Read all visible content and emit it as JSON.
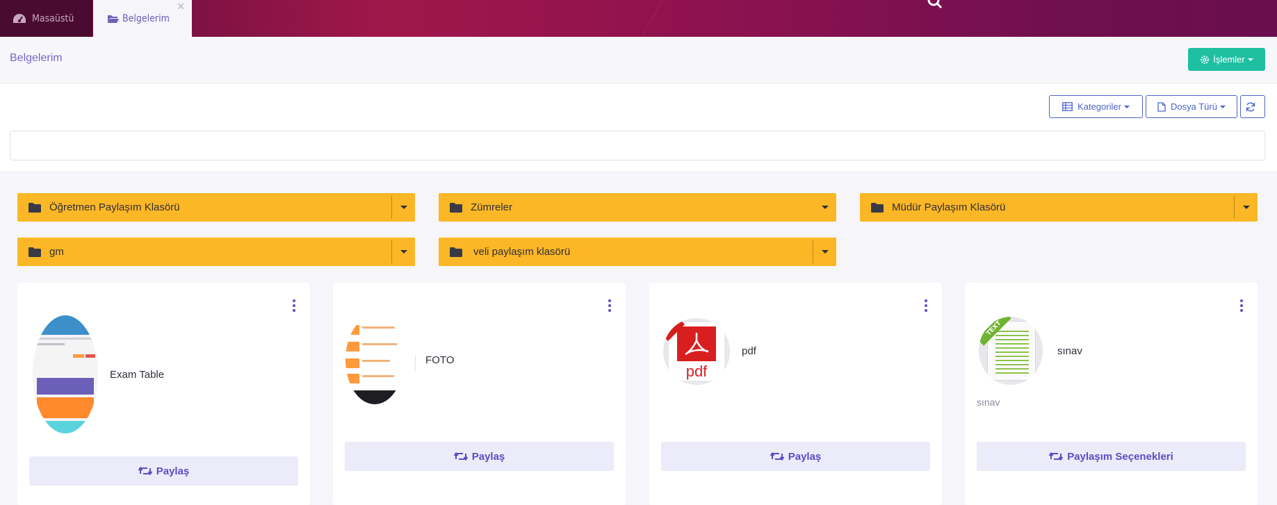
{
  "tabs": {
    "home_label": "Masaüstü",
    "active_label": "Belgelerim",
    "close_symbol": "×"
  },
  "header": {
    "title": "Belgelerim",
    "actions_label": "İşlemler"
  },
  "filters": {
    "categories_label": "Kategoriler",
    "filetype_label": "Dosya Türü"
  },
  "folders": [
    {
      "name": "Öğretmen Paylaşım Klasörü"
    },
    {
      "name": "Zümreler"
    },
    {
      "name": "Müdür Paylaşım Klasörü"
    },
    {
      "name": "gm"
    },
    {
      "name": "veli paylaşım klasörü"
    }
  ],
  "cards": [
    {
      "title": "Exam Table",
      "subtitle": "",
      "button": "Paylaş",
      "icon": "app-screenshot-thumb"
    },
    {
      "title": "FOTO",
      "subtitle": "",
      "button": "Paylaş",
      "icon": "photo-thumb"
    },
    {
      "title": "pdf",
      "subtitle": "",
      "button": "Paylaş",
      "icon": "pdf-icon"
    },
    {
      "title": "sınav",
      "subtitle": "sınav",
      "button": "Paylaşım Seçenekleri",
      "icon": "text-file-icon"
    }
  ],
  "thumb_texts": {
    "pdf_label": "pdf",
    "text_label": "TEXT"
  },
  "colors": {
    "accent": "#5b4ec2",
    "folder": "#fbb725",
    "actions_button": "#1fc0a2",
    "outline_button": "#4a63c9"
  }
}
